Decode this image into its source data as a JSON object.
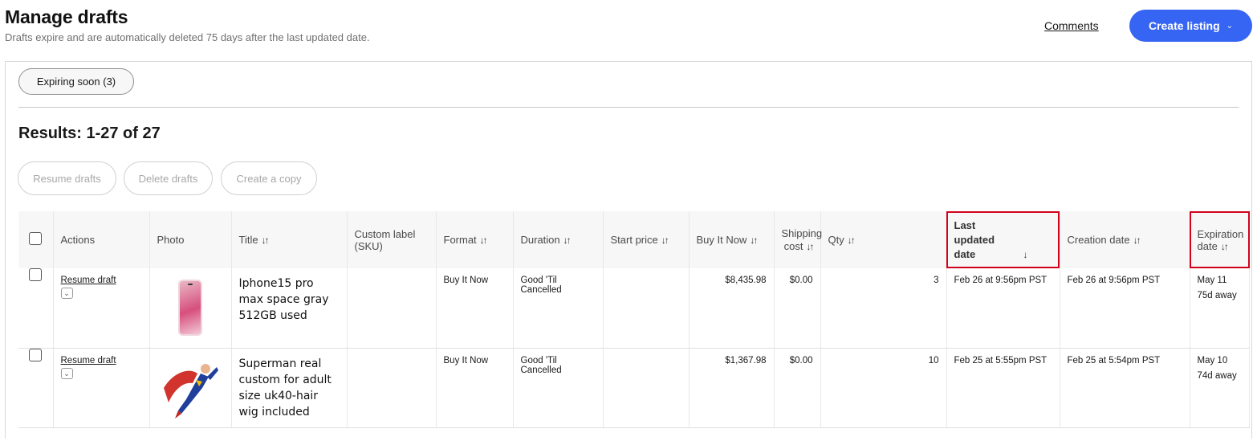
{
  "header": {
    "title": "Manage drafts",
    "subtitle": "Drafts expire and are automatically deleted 75 days after the last updated date.",
    "comments_label": "Comments",
    "create_label": "Create listing"
  },
  "filters": {
    "expiring_label": "Expiring soon (3)"
  },
  "results_label": "Results: 1-27 of 27",
  "bulk_actions": {
    "resume": "Resume drafts",
    "delete": "Delete drafts",
    "copy": "Create a copy"
  },
  "columns": {
    "actions": "Actions",
    "photo": "Photo",
    "title": "Title",
    "sku": "Custom label (SKU)",
    "format": "Format",
    "duration": "Duration",
    "start_price": "Start price",
    "bin": "Buy It Now",
    "shipping": "Shipping cost",
    "qty": "Qty",
    "last_updated": "Last updated date",
    "creation": "Creation date",
    "expiration": "Expiration date"
  },
  "rows": [
    {
      "action": "Resume draft",
      "photo_icon": "phone-image",
      "title": "Iphone15 pro max space gray 512GB used",
      "sku": "",
      "format": "Buy It Now",
      "duration": "Good 'Til Cancelled",
      "start_price": "",
      "bin": "$8,435.98",
      "shipping": "$0.00",
      "qty": "3",
      "last_updated": "Feb 26 at 9:56pm PST",
      "creation": "Feb 26 at 9:56pm PST",
      "expiration": "May 11",
      "expiration_away": "75d away"
    },
    {
      "action": "Resume draft",
      "photo_icon": "superhero-image",
      "title": "Superman real custom for adult size uk40-hair wig included",
      "sku": "",
      "format": "Buy It Now",
      "duration": "Good 'Til Cancelled",
      "start_price": "",
      "bin": "$1,367.98",
      "shipping": "$0.00",
      "qty": "10",
      "last_updated": "Feb 25 at 5:55pm PST",
      "creation": "Feb 25 at 5:54pm PST",
      "expiration": "May 10",
      "expiration_away": "74d away"
    }
  ],
  "colors": {
    "accent": "#3665f3",
    "highlight": "#d0021b"
  }
}
